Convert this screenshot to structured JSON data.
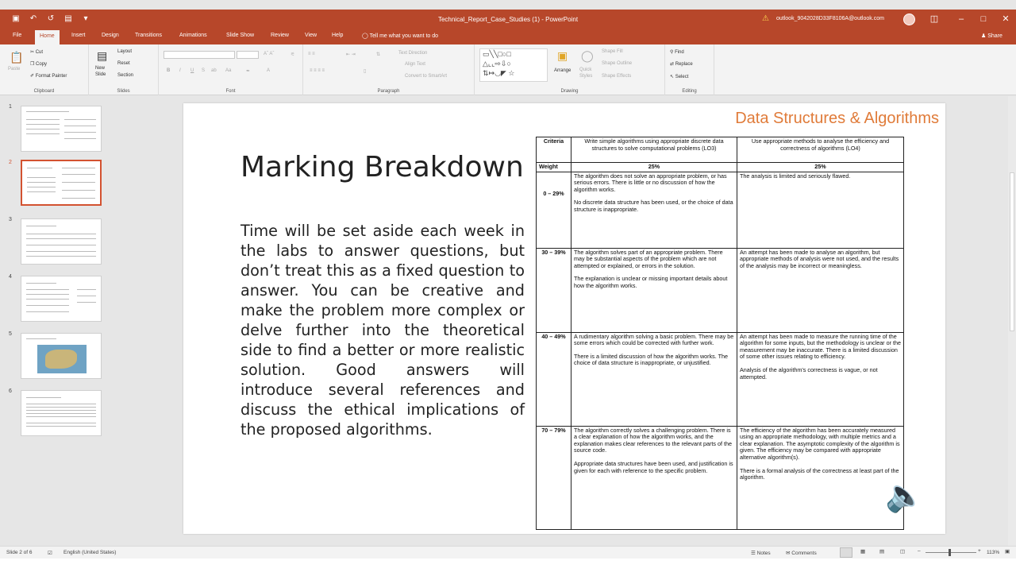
{
  "window": {
    "title": "Technical_Report_Case_Studies (1) - PowerPoint",
    "account": "outlook_9042028D33F8106A@outlook.com"
  },
  "menu": {
    "tabs": [
      "File",
      "Home",
      "Insert",
      "Design",
      "Transitions",
      "Animations",
      "Slide Show",
      "Review",
      "View",
      "Help"
    ],
    "active_tab": "Home",
    "tell_me": "Tell me what you want to do",
    "share": "Share"
  },
  "ribbon": {
    "clipboard": {
      "label": "Clipboard",
      "paste": "Paste",
      "cut": "Cut",
      "copy": "Copy",
      "format_painter": "Format Painter"
    },
    "slides": {
      "label": "Slides",
      "new_slide": "New Slide",
      "layout": "Layout",
      "reset": "Reset",
      "section": "Section"
    },
    "font": {
      "label": "Font"
    },
    "paragraph": {
      "label": "Paragraph",
      "text_direction": "Text Direction",
      "align_text": "Align Text",
      "convert_smartart": "Convert to SmartArt"
    },
    "drawing": {
      "label": "Drawing",
      "arrange": "Arrange",
      "quick_styles": "Quick Styles",
      "shape_fill": "Shape Fill",
      "shape_outline": "Shape Outline",
      "shape_effects": "Shape Effects"
    },
    "editing": {
      "label": "Editing",
      "find": "Find",
      "replace": "Replace",
      "select": "Select"
    }
  },
  "thumbnails": {
    "numbers": [
      "1",
      "2",
      "3",
      "4",
      "5",
      "6"
    ],
    "active": 2
  },
  "slide": {
    "header": "Data Structures & Algorithms",
    "title": "Marking Breakdown",
    "body": "Time will be set aside each week in the labs to answer questions, but don’t treat this as a fixed question to answer. You can be creative and make the problem more complex or delve further into the theoretical side to find a better or more realistic solution. Good answers will introduce several references and discuss the ethical implications of the proposed algorithms.",
    "table": {
      "headers": [
        "Criteria",
        "Write simple algorithms using appropriate discrete data structures to solve computational problems (LO3)",
        "Use appropriate methods to analyse the efficiency and correctness of algorithms (LO4)"
      ],
      "weight": [
        "Weight",
        "25%",
        "25%"
      ],
      "rows": [
        {
          "band": "0 – 29%",
          "lo3": [
            "The algorithm does not solve an appropriate problem, or has serious errors. There is little or no discussion of how the algorithm works.",
            "No discrete data structure has been used, or the choice of data structure is inappropriate."
          ],
          "lo4": [
            "The analysis is limited and seriously flawed."
          ]
        },
        {
          "band": "30 – 39%",
          "lo3": [
            "The algorithm solves part of an appropriate problem. There may be substantial aspects of the problem which are not attempted or explained, or errors in the solution.",
            "The explanation is unclear or missing important details about how the algorithm works."
          ],
          "lo4": [
            "An attempt has been made to analyse an algorithm, but appropriate methods of analysis were not used, and the results of the analysis may be incorrect or meaningless."
          ]
        },
        {
          "band": "40 – 49%",
          "lo3": [
            "A rudimentary algorithm solving a basic problem. There may be some errors which could be corrected with further work.",
            "There is a limited discussion of how the algorithm works. The choice of data structure is inappropriate, or unjustified."
          ],
          "lo4": [
            "An attempt has been made to measure the running time of the algorithm for some inputs, but the methodology is unclear or the measurement may be inaccurate. There is a limited discussion of some other issues relating to efficiency.",
            "Analysis of the algorithm’s correctness is vague, or not attempted."
          ]
        },
        {
          "band": "70 – 79%",
          "lo3": [
            "The algorithm correctly solves a challenging problem. There is a clear explanation of how the algorithm works, and the explanation makes clear references to the relevant parts of the source code.",
            "Appropriate data structures have been used, and justification is given for each with reference to the specific problem."
          ],
          "lo4": [
            "The efficiency of the algorithm has been accurately measured using an appropriate methodology, with multiple metrics and a clear explanation. The asymptotic complexity of the algorithm is given. The efficiency may be compared with appropriate alternative algorithm(s).",
            "There is a formal analysis of the correctness at least part of the algorithm."
          ]
        }
      ]
    }
  },
  "status": {
    "slide_info": "Slide 2 of 6",
    "language": "English (United States)",
    "notes": "Notes",
    "comments": "Comments",
    "zoom": "113%"
  }
}
